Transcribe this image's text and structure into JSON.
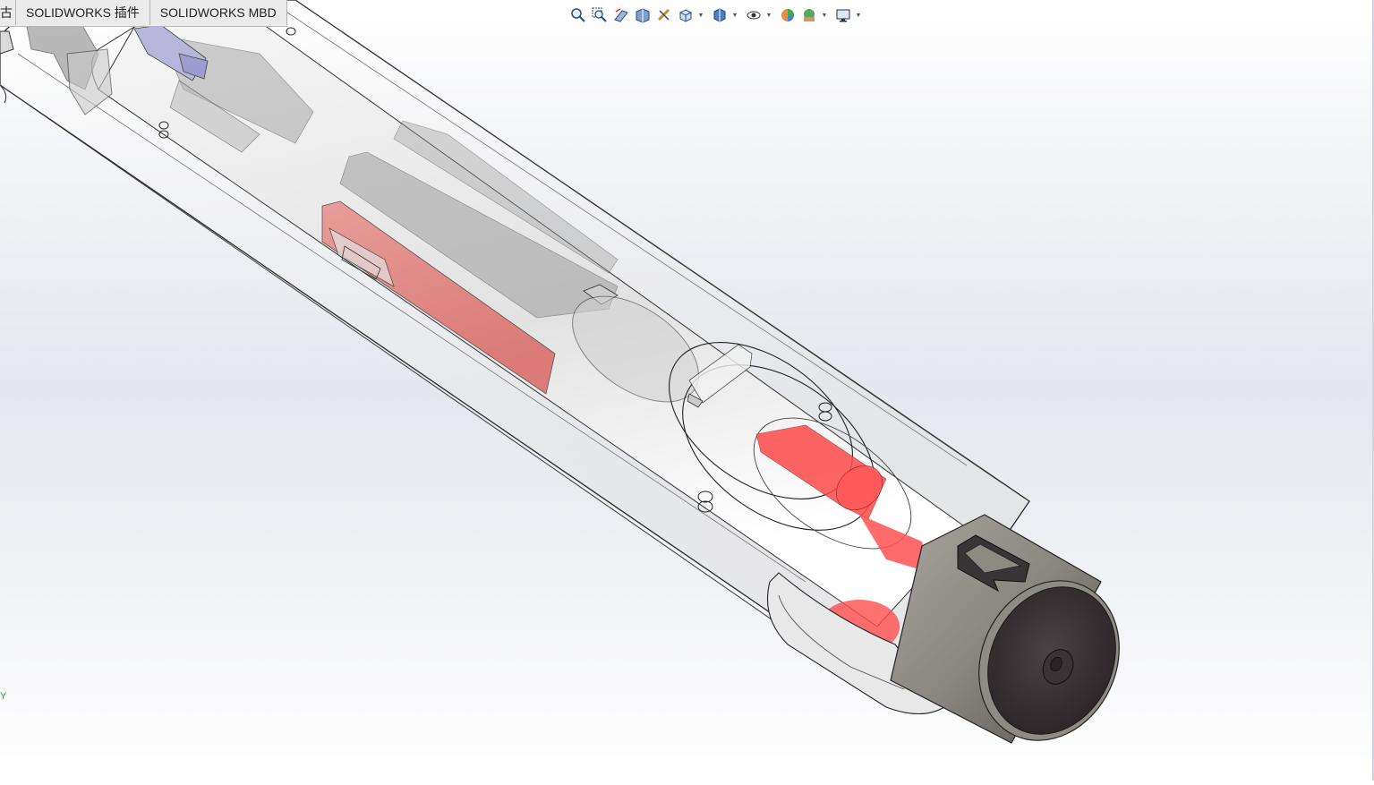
{
  "tabs": [
    {
      "label": "古",
      "partial": true
    },
    {
      "label": "SOLIDWORKS 插件"
    },
    {
      "label": "SOLIDWORKS MBD"
    }
  ],
  "toolbar": {
    "icons": [
      "zoom-to-fit-icon",
      "zoom-to-area-icon",
      "previous-view-icon",
      "section-view-icon",
      "dynamic-annotation-views-icon",
      "view-orientation-icon",
      "display-style-icon",
      "hide-show-items-icon",
      "edit-appearance-icon",
      "apply-scene-icon",
      "view-settings-icon"
    ]
  },
  "triad": {
    "label": "Y"
  },
  "colors": {
    "accent_red": "#ff3c3c",
    "cap_gray": "#8e8a84",
    "cap_face": "#3d3538",
    "viewport_top": "#ffffff",
    "viewport_mid": "#e4e7ee"
  }
}
